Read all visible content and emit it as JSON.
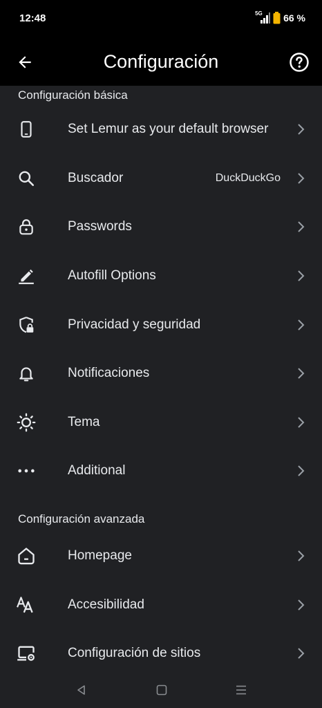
{
  "status_bar": {
    "time": "12:48",
    "network": "5G",
    "battery": "66 %"
  },
  "app_bar": {
    "title": "Configuración",
    "back_icon": "arrow-left-icon",
    "help_icon": "help-circle-icon"
  },
  "sections": {
    "basic": {
      "title": "Configuración básica",
      "items": [
        {
          "label": "Set Lemur as your default browser",
          "icon": "phone-icon"
        },
        {
          "label": "Buscador",
          "value": "DuckDuckGo",
          "icon": "search-icon"
        },
        {
          "label": "Passwords",
          "icon": "lock-icon"
        },
        {
          "label": "Autofill Options",
          "icon": "pencil-icon"
        },
        {
          "label": "Privacidad y seguridad",
          "icon": "shield-lock-icon"
        },
        {
          "label": "Notificaciones",
          "icon": "bell-icon"
        },
        {
          "label": "Tema",
          "icon": "brightness-icon"
        },
        {
          "label": "Additional",
          "icon": "more-horiz-icon"
        }
      ]
    },
    "advanced": {
      "title": "Configuración avanzada",
      "items": [
        {
          "label": "Homepage",
          "icon": "home-icon"
        },
        {
          "label": "Accesibilidad",
          "icon": "text-size-icon"
        },
        {
          "label": "Configuración de sitios",
          "icon": "site-settings-icon"
        }
      ]
    }
  },
  "nav_bar": {
    "back": "nav-back-icon",
    "home": "nav-home-icon",
    "recents": "nav-recents-icon"
  },
  "colors": {
    "background": "#202124",
    "bar": "#000000",
    "text": "#e8eaed",
    "chevron": "#9aa0a6",
    "battery": "#f4b400"
  }
}
